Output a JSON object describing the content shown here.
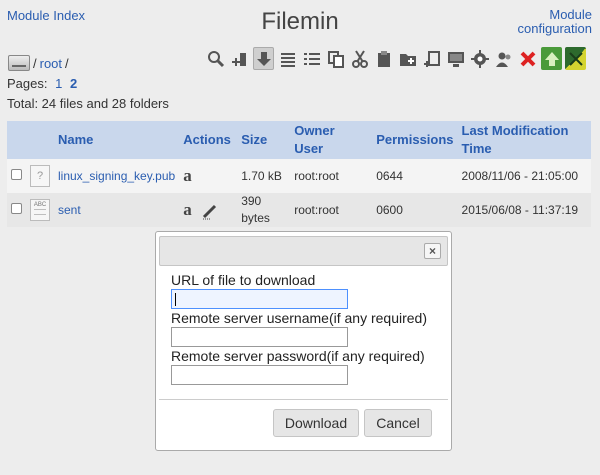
{
  "header": {
    "module_index": "Module Index",
    "title": "Filemin",
    "module_configuration_line1": "Module",
    "module_configuration_line2": "configuration"
  },
  "path": {
    "prefix": "/",
    "root_link": "root",
    "suffix": "/"
  },
  "pages": {
    "label": "Pages:",
    "items": [
      "1",
      "2"
    ],
    "current": "2"
  },
  "total": "Total: 24 files and 28 folders",
  "toolbar": {
    "icons": [
      "search-icon",
      "bookmark-add-icon",
      "download-icon",
      "list-icon",
      "detailed-list-icon",
      "copy-icon",
      "cut-icon",
      "paste-icon",
      "new-folder-icon",
      "new-file-icon",
      "terminal-icon",
      "settings-icon",
      "users-icon",
      "delete-icon",
      "upload-icon",
      "tinycore-icon"
    ]
  },
  "table": {
    "headers": {
      "name": "Name",
      "actions": "Actions",
      "size": "Size",
      "owner_line1": "Owner",
      "owner_line2": "User",
      "permissions": "Permissions",
      "modified_line1": "Last Modification",
      "modified_line2": "Time"
    },
    "rows": [
      {
        "name": "linux_signing_key.pub",
        "size": "1.70 kB",
        "owner": "root:root",
        "permissions": "0644",
        "modified": "2008/11/06 - 21:05:00",
        "icon": "unknown-file-icon"
      },
      {
        "name": "sent",
        "size_line1": "390",
        "size_line2": "bytes",
        "owner": "root:root",
        "permissions": "0600",
        "modified": "2015/06/08 - 11:37:19",
        "icon": "text-file-icon"
      }
    ]
  },
  "dialog": {
    "close_symbol": "×",
    "url_label": "URL of file to download",
    "url_value": "",
    "username_label": "Remote server username(if any required)",
    "username_value": "",
    "password_label": "Remote server password(if any required)",
    "password_value": "",
    "download_button": "Download",
    "cancel_button": "Cancel"
  },
  "colors": {
    "link": "#2a5db0",
    "table_header": "#c9d7ec",
    "background": "#ededed",
    "delete": "#d22",
    "upload": "#4a9a3a"
  }
}
